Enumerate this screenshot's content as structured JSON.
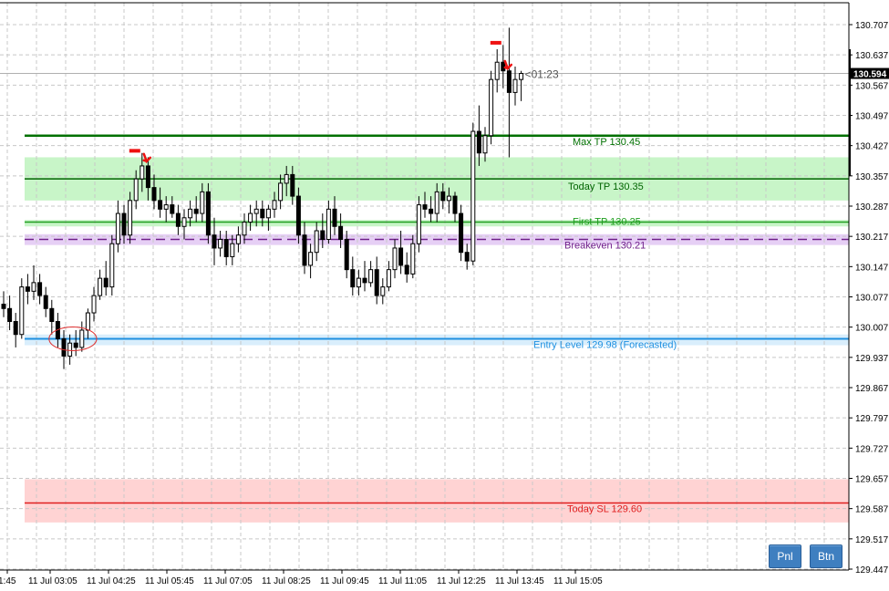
{
  "chart_data": {
    "type": "candlestick",
    "y_range": [
      129.447,
      130.707
    ],
    "y_ticks": [
      "130.707",
      "130.637",
      "130.567",
      "130.497",
      "130.427",
      "130.357",
      "130.287",
      "130.217",
      "130.147",
      "130.077",
      "130.007",
      "129.937",
      "129.867",
      "129.797",
      "129.727",
      "129.657",
      "129.587",
      "129.517",
      "129.447"
    ],
    "x_ticks": [
      "1:45",
      "11 Jul 03:05",
      "11 Jul 04:25",
      "11 Jul 05:45",
      "11 Jul 07:05",
      "11 Jul 08:25",
      "11 Jul 09:45",
      "11 Jul 11:05",
      "11 Jul 12:25",
      "11 Jul 13:45",
      "11 Jul 15:05"
    ],
    "current_price": "130.594",
    "countdown": "<01:23",
    "levels": [
      {
        "name": "Max TP",
        "label": "Max TP 130.45",
        "price": 130.45,
        "color": "#007000",
        "zone": null
      },
      {
        "name": "Today TP",
        "label": "Today TP 130.35",
        "price": 130.35,
        "color": "#006400",
        "zone": [
          130.3,
          130.4
        ],
        "zone_color": "#c8f5c8"
      },
      {
        "name": "First TP",
        "label": "First TP 130.25",
        "price": 130.25,
        "color": "#1f9e1f",
        "zone": [
          130.24,
          130.255
        ],
        "zone_color": "#c8f5c8"
      },
      {
        "name": "Breakeven",
        "label": "Breakeven 130.21",
        "price": 130.21,
        "color": "#70208a",
        "zone": [
          130.197,
          130.222
        ],
        "zone_color": "#e6cff5"
      },
      {
        "name": "Entry Level",
        "label": "Entry Level 129.98 (Forecasted)",
        "price": 129.98,
        "color": "#1e90e0",
        "zone": [
          129.965,
          129.99
        ],
        "zone_color": "#d9eefc"
      },
      {
        "name": "Today SL",
        "label": "Today SL 129.60",
        "price": 129.6,
        "color": "#e02020",
        "zone": [
          129.555,
          129.655
        ],
        "zone_color": "#ffd3d3"
      }
    ],
    "candles": [
      [
        130.06,
        130.09,
        130.03,
        130.05
      ],
      [
        130.05,
        130.08,
        130.0,
        130.02
      ],
      [
        130.02,
        130.04,
        129.96,
        129.99
      ],
      [
        129.99,
        130.12,
        129.98,
        130.1
      ],
      [
        130.1,
        130.13,
        130.06,
        130.09
      ],
      [
        130.09,
        130.15,
        130.07,
        130.11
      ],
      [
        130.11,
        130.13,
        130.06,
        130.08
      ],
      [
        130.08,
        130.1,
        130.03,
        130.05
      ],
      [
        130.05,
        130.07,
        129.99,
        130.02
      ],
      [
        130.02,
        130.04,
        129.96,
        129.98
      ],
      [
        129.98,
        130.0,
        129.91,
        129.94
      ],
      [
        129.94,
        129.99,
        129.92,
        129.97
      ],
      [
        129.97,
        130.0,
        129.94,
        129.96
      ],
      [
        129.96,
        130.02,
        129.95,
        130.0
      ],
      [
        130.0,
        130.05,
        129.98,
        130.04
      ],
      [
        130.04,
        130.1,
        130.02,
        130.08
      ],
      [
        130.08,
        130.14,
        130.07,
        130.12
      ],
      [
        130.12,
        130.16,
        130.08,
        130.1
      ],
      [
        130.1,
        130.22,
        130.08,
        130.2
      ],
      [
        130.2,
        130.3,
        130.18,
        130.27
      ],
      [
        130.27,
        130.29,
        130.2,
        130.22
      ],
      [
        130.22,
        130.32,
        130.2,
        130.3
      ],
      [
        130.3,
        130.37,
        130.28,
        130.35
      ],
      [
        130.35,
        130.41,
        130.32,
        130.38
      ],
      [
        130.38,
        130.4,
        130.3,
        130.33
      ],
      [
        130.33,
        130.36,
        130.28,
        130.3
      ],
      [
        130.3,
        130.33,
        130.26,
        130.28
      ],
      [
        130.28,
        130.31,
        130.25,
        130.29
      ],
      [
        130.29,
        130.31,
        130.26,
        130.27
      ],
      [
        130.27,
        130.29,
        130.22,
        130.24
      ],
      [
        130.24,
        130.28,
        130.21,
        130.26
      ],
      [
        130.26,
        130.3,
        130.24,
        130.28
      ],
      [
        130.28,
        130.31,
        130.25,
        130.27
      ],
      [
        130.27,
        130.34,
        130.25,
        130.32
      ],
      [
        130.32,
        130.34,
        130.2,
        130.22
      ],
      [
        130.22,
        130.26,
        130.15,
        130.19
      ],
      [
        130.19,
        130.23,
        130.17,
        130.21
      ],
      [
        130.21,
        130.23,
        130.15,
        130.17
      ],
      [
        130.17,
        130.22,
        130.15,
        130.2
      ],
      [
        130.2,
        130.24,
        130.18,
        130.22
      ],
      [
        130.22,
        130.27,
        130.2,
        130.25
      ],
      [
        130.25,
        130.29,
        130.23,
        130.27
      ],
      [
        130.27,
        130.3,
        130.24,
        130.28
      ],
      [
        130.28,
        130.3,
        130.24,
        130.26
      ],
      [
        130.26,
        130.29,
        130.23,
        130.28
      ],
      [
        130.28,
        130.32,
        130.26,
        130.3
      ],
      [
        130.3,
        130.36,
        130.28,
        130.34
      ],
      [
        130.34,
        130.38,
        130.31,
        130.36
      ],
      [
        130.36,
        130.38,
        130.29,
        130.31
      ],
      [
        130.31,
        130.33,
        130.2,
        130.22
      ],
      [
        130.22,
        130.25,
        130.13,
        130.15
      ],
      [
        130.15,
        130.2,
        130.12,
        130.18
      ],
      [
        130.18,
        130.25,
        130.16,
        130.23
      ],
      [
        130.23,
        130.27,
        130.19,
        130.21
      ],
      [
        130.21,
        130.3,
        130.2,
        130.28
      ],
      [
        130.28,
        130.31,
        130.22,
        130.24
      ],
      [
        130.24,
        130.27,
        130.19,
        130.21
      ],
      [
        130.21,
        130.23,
        130.12,
        130.14
      ],
      [
        130.14,
        130.17,
        130.08,
        130.1
      ],
      [
        130.1,
        130.14,
        130.08,
        130.12
      ],
      [
        130.12,
        130.16,
        130.09,
        130.11
      ],
      [
        130.11,
        130.16,
        130.1,
        130.14
      ],
      [
        130.14,
        130.17,
        130.06,
        130.08
      ],
      [
        130.08,
        130.12,
        130.06,
        130.1
      ],
      [
        130.1,
        130.16,
        130.09,
        130.14
      ],
      [
        130.14,
        130.21,
        130.12,
        130.19
      ],
      [
        130.19,
        130.23,
        130.13,
        130.15
      ],
      [
        130.15,
        130.18,
        130.11,
        130.13
      ],
      [
        130.13,
        130.22,
        130.12,
        130.2
      ],
      [
        130.2,
        130.31,
        130.18,
        130.29
      ],
      [
        130.29,
        130.32,
        130.26,
        130.28
      ],
      [
        130.28,
        130.31,
        130.25,
        130.27
      ],
      [
        130.27,
        130.34,
        130.25,
        130.32
      ],
      [
        130.32,
        130.34,
        130.28,
        130.3
      ],
      [
        130.3,
        130.33,
        130.27,
        130.31
      ],
      [
        130.31,
        130.32,
        130.25,
        130.27
      ],
      [
        130.27,
        130.29,
        130.16,
        130.18
      ],
      [
        130.18,
        130.2,
        130.14,
        130.16
      ],
      [
        130.16,
        130.48,
        130.15,
        130.46
      ],
      [
        130.46,
        130.52,
        130.38,
        130.41
      ],
      [
        130.41,
        130.47,
        130.39,
        130.45
      ],
      [
        130.45,
        130.6,
        130.43,
        130.58
      ],
      [
        130.58,
        130.65,
        130.55,
        130.62
      ],
      [
        130.62,
        130.66,
        130.56,
        130.6
      ],
      [
        130.6,
        130.7,
        130.4,
        130.55
      ],
      [
        130.55,
        130.61,
        130.52,
        130.58
      ],
      [
        130.58,
        130.6,
        130.53,
        130.594
      ]
    ],
    "arrows": [
      {
        "candle": 23,
        "price": 130.395,
        "dash_price": 130.415
      },
      {
        "candle": 83,
        "price": 130.61,
        "dash_price": 130.665
      }
    ],
    "ellipse": {
      "candle_from": 8,
      "candle_to": 15,
      "price": 129.98
    },
    "buttons": {
      "pnl": "Pnl",
      "btn": "Btn"
    }
  }
}
